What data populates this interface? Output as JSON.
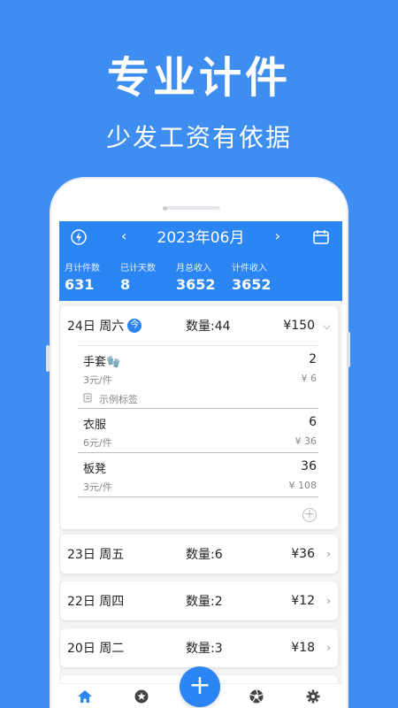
{
  "promo": {
    "title": "专业计件",
    "subtitle": "少发工资有依据"
  },
  "header": {
    "month": "2023年06月",
    "prev_arrow": "‹",
    "next_arrow": "›",
    "icons": {
      "left": "lightning-icon",
      "right": "calendar-icon"
    },
    "stats": [
      {
        "label": "月计件数",
        "value": "631"
      },
      {
        "label": "已计天数",
        "value": "8"
      },
      {
        "label": "月总收入",
        "value": "3652"
      },
      {
        "label": "计件收入",
        "value": "3652"
      }
    ]
  },
  "days": [
    {
      "date": "24日 周六",
      "today_badge": "今",
      "qty": "数量:44",
      "amount": "¥150",
      "expanded": true,
      "items": [
        {
          "name": "手套🧤",
          "qty": "2",
          "price": "3元/件",
          "total": "¥ 6",
          "tag": "示例标签"
        },
        {
          "name": "衣服",
          "qty": "6",
          "price": "6元/件",
          "total": "¥ 36"
        },
        {
          "name": "板凳",
          "qty": "36",
          "price": "3元/件",
          "total": "¥ 108"
        }
      ]
    },
    {
      "date": "23日 周五",
      "qty": "数量:6",
      "amount": "¥36"
    },
    {
      "date": "22日 周四",
      "qty": "数量:2",
      "amount": "¥12"
    },
    {
      "date": "20日 周二",
      "qty": "数量:3",
      "amount": "¥18"
    }
  ],
  "tabbar": {
    "tabs": [
      "home-icon",
      "star-icon",
      "add-icon",
      "aperture-icon",
      "settings-icon"
    ],
    "fab_label": "+"
  },
  "colors": {
    "primary": "#2b85f2",
    "background": "#3d8ef0"
  }
}
